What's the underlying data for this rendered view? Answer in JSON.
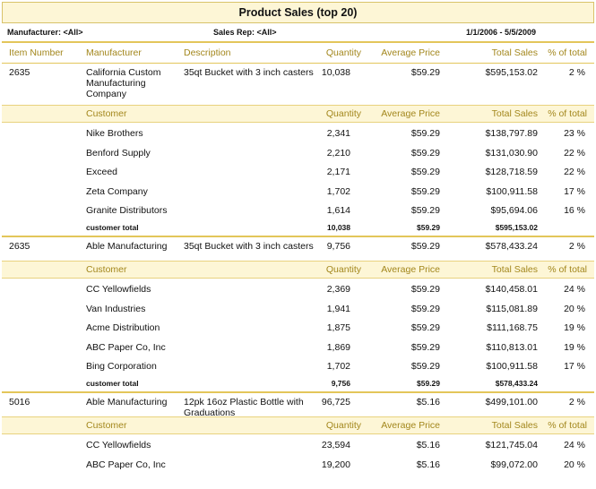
{
  "report": {
    "title": "Product Sales (top 20)",
    "manufacturer_filter": "Manufacturer: <All>",
    "sales_rep_filter": "Sales Rep: <All>",
    "date_range": "1/1/2006  -  5/5/2009"
  },
  "columns": {
    "item_number": "Item Number",
    "manufacturer": "Manufacturer",
    "description": "Description",
    "quantity": "Quantity",
    "average_price": "Average Price",
    "total_sales": "Total Sales",
    "pct_total": "% of total"
  },
  "customer_columns": {
    "customer": "Customer",
    "quantity": "Quantity",
    "average_price": "Average Price",
    "total_sales": "Total Sales",
    "pct_total": "% of total"
  },
  "products": [
    {
      "item_number": "2635",
      "manufacturer": "California Custom Manufacturing Company",
      "description": "35qt Bucket with 3 inch casters",
      "quantity": "10,038",
      "average_price": "$59.29",
      "total_sales": "$595,153.02",
      "pct_total": "2 %",
      "customers": [
        {
          "name": "Nike Brothers",
          "quantity": "2,341",
          "average_price": "$59.29",
          "total_sales": "$138,797.89",
          "pct": "23 %"
        },
        {
          "name": "Benford Supply",
          "quantity": "2,210",
          "average_price": "$59.29",
          "total_sales": "$131,030.90",
          "pct": "22 %"
        },
        {
          "name": "Exceed",
          "quantity": "2,171",
          "average_price": "$59.29",
          "total_sales": "$128,718.59",
          "pct": "22 %"
        },
        {
          "name": "Zeta Company",
          "quantity": "1,702",
          "average_price": "$59.29",
          "total_sales": "$100,911.58",
          "pct": "17 %"
        },
        {
          "name": "Granite Distributors",
          "quantity": "1,614",
          "average_price": "$59.29",
          "total_sales": "$95,694.06",
          "pct": "16 %"
        }
      ],
      "total": {
        "label": "customer total",
        "quantity": "10,038",
        "average_price": "$59.29",
        "total_sales": "$595,153.02"
      }
    },
    {
      "item_number": "2635",
      "manufacturer": "Able Manufacturing",
      "description": "35qt Bucket with 3 inch casters",
      "quantity": "9,756",
      "average_price": "$59.29",
      "total_sales": "$578,433.24",
      "pct_total": "2 %",
      "customers": [
        {
          "name": "CC Yellowfields",
          "quantity": "2,369",
          "average_price": "$59.29",
          "total_sales": "$140,458.01",
          "pct": "24 %"
        },
        {
          "name": "Van Industries",
          "quantity": "1,941",
          "average_price": "$59.29",
          "total_sales": "$115,081.89",
          "pct": "20 %"
        },
        {
          "name": "Acme Distribution",
          "quantity": "1,875",
          "average_price": "$59.29",
          "total_sales": "$111,168.75",
          "pct": "19 %"
        },
        {
          "name": "ABC Paper Co, Inc",
          "quantity": "1,869",
          "average_price": "$59.29",
          "total_sales": "$110,813.01",
          "pct": "19 %"
        },
        {
          "name": "Bing Corporation",
          "quantity": "1,702",
          "average_price": "$59.29",
          "total_sales": "$100,911.58",
          "pct": "17 %"
        }
      ],
      "total": {
        "label": "customer total",
        "quantity": "9,756",
        "average_price": "$59.29",
        "total_sales": "$578,433.24"
      }
    },
    {
      "item_number": "5016",
      "manufacturer": "Able Manufacturing",
      "description": "12pk 16oz Plastic Bottle with Graduations",
      "quantity": "96,725",
      "average_price": "$5.16",
      "total_sales": "$499,101.00",
      "pct_total": "2 %",
      "customers": [
        {
          "name": "CC Yellowfields",
          "quantity": "23,594",
          "average_price": "$5.16",
          "total_sales": "$121,745.04",
          "pct": "24 %"
        },
        {
          "name": "ABC Paper Co, Inc",
          "quantity": "19,200",
          "average_price": "$5.16",
          "total_sales": "$99,072.00",
          "pct": "20 %"
        }
      ]
    }
  ]
}
